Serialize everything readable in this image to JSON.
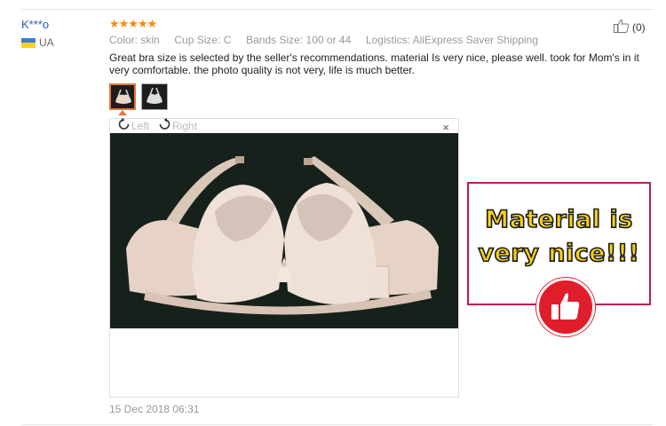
{
  "review": {
    "user": "K***o",
    "country": "UA",
    "stars": "★★★★★",
    "meta": {
      "color_label": "Color:",
      "color_value": "skin",
      "cup_label": "Cup Size:",
      "cup_value": "C",
      "band_label": "Bands Size:",
      "band_value": "100 or 44",
      "logistics_label": "Logistics:",
      "logistics_value": "AliExpress Saver Shipping"
    },
    "text": "Great bra size is selected by the seller's recommendations. material Is very nice, please well. took for Mom's in it very comfortable. the photo quality is not very, life is much better.",
    "helpful_count": "(0)",
    "date": "15 Dec 2018 06:31"
  },
  "viewer": {
    "rotate_left": "Left",
    "rotate_right": "Right",
    "close": "×"
  },
  "promo": {
    "line1": "Material is",
    "line2": "very nice!!!"
  },
  "colors": {
    "accent": "#e8743b",
    "link": "#2a5db0",
    "promo_border": "#c2185b",
    "promo_text": "#f7d117",
    "badge": "#e01e2b",
    "star": "#ff8a00",
    "flag_top": "#3a7bd5",
    "flag_bottom": "#f6d21a"
  },
  "icons": [
    "thumbs-up-icon",
    "rotate-left-icon",
    "rotate-right-icon",
    "close-icon",
    "thumbs-up-badge-icon"
  ]
}
